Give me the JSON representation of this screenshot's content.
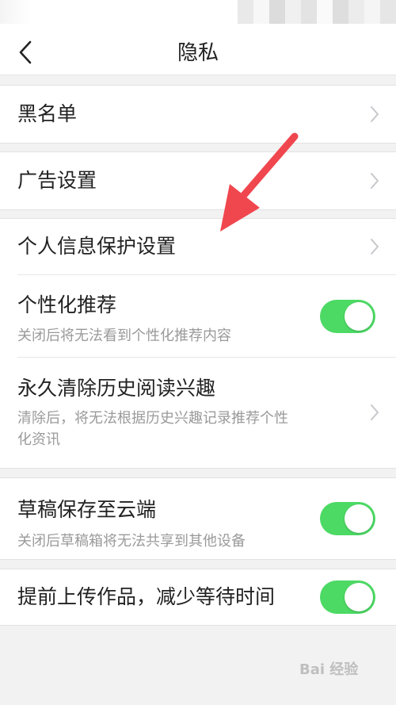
{
  "nav": {
    "title": "隐私"
  },
  "items": {
    "blacklist": {
      "title": "黑名单"
    },
    "ad_settings": {
      "title": "广告设置"
    },
    "personal_info": {
      "title": "个人信息保护设置"
    },
    "personalized": {
      "title": "个性化推荐",
      "desc": "关闭后将无法看到个性化推荐内容",
      "enabled": true
    },
    "clear_history": {
      "title": "永久清除历史阅读兴趣",
      "desc_line1": "清除后，将无法根据历史兴趣记录推荐个性",
      "desc_line2": "化资讯"
    },
    "draft_cloud": {
      "title": "草稿保存至云端",
      "desc": "关闭后草稿箱将无法共享到其他设备",
      "enabled": true
    },
    "upload_ahead": {
      "title": "提前上传作品，减少等待时间",
      "enabled": true
    }
  },
  "colors": {
    "toggle_on": "#4cd964",
    "annotation_arrow": "#f0474f",
    "chevron": "#c7c7cc"
  },
  "watermark": "Bai 经验"
}
